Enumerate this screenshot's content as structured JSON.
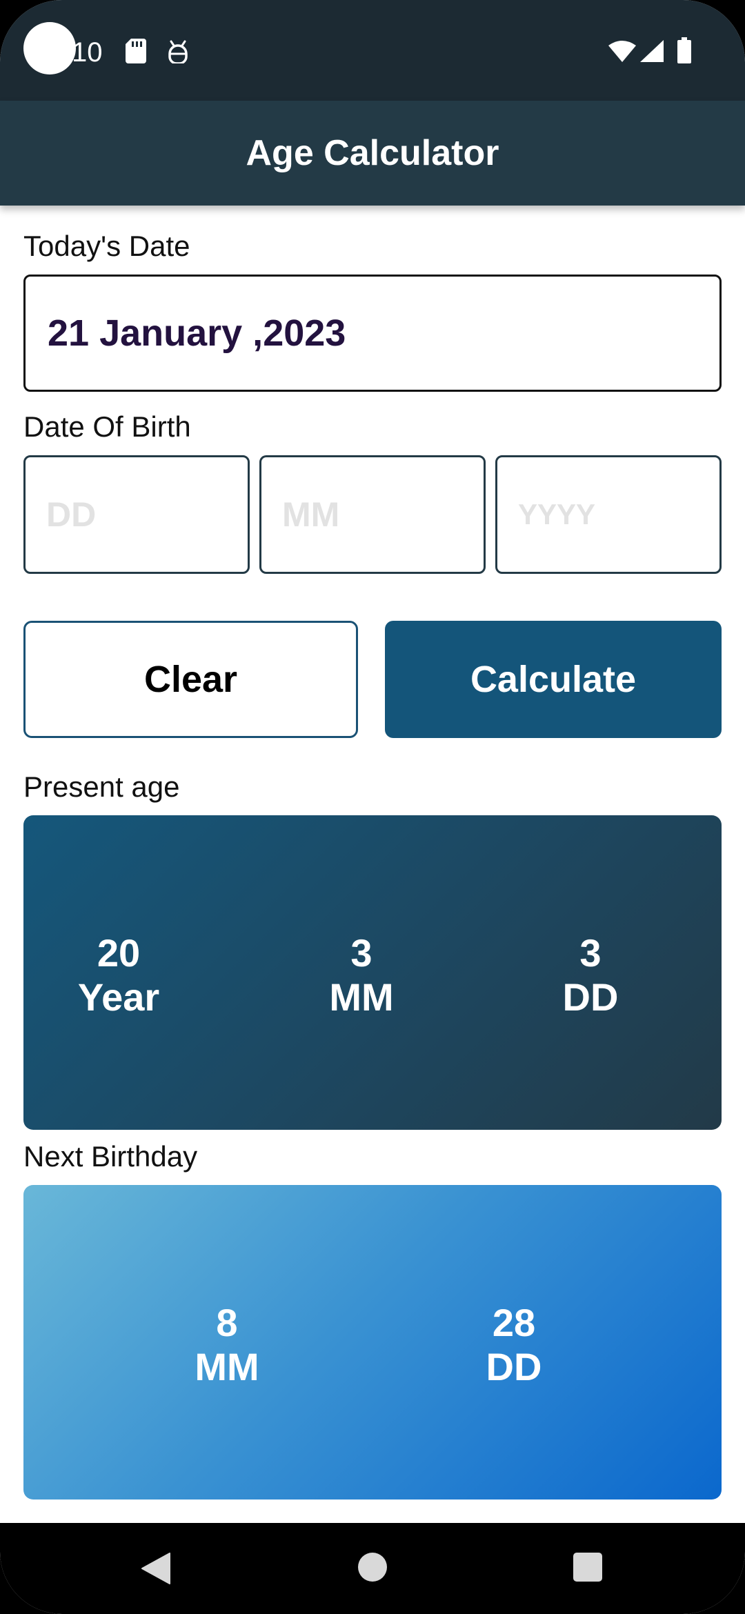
{
  "status_bar": {
    "time": "10",
    "icons": [
      "sd-card-icon",
      "android-debug-icon",
      "wifi-icon",
      "signal-icon",
      "battery-icon"
    ]
  },
  "app_bar": {
    "title": "Age Calculator"
  },
  "today": {
    "label": "Today's Date",
    "value": "21 January ,2023"
  },
  "dob": {
    "label": "Date Of Birth",
    "day_placeholder": "DD",
    "month_placeholder": "MM",
    "year_placeholder": "YYYY"
  },
  "buttons": {
    "clear_label": "Clear",
    "calculate_label": "Calculate"
  },
  "present_age": {
    "label": "Present age",
    "years_value": "20",
    "years_unit": "Year",
    "months_value": "3",
    "months_unit": "MM",
    "days_value": "3",
    "days_unit": "DD"
  },
  "next_birthday": {
    "label": "Next Birthday",
    "months_value": "8",
    "months_unit": "MM",
    "days_value": "28",
    "days_unit": "DD"
  },
  "nav_bar": {
    "icons": [
      "back-icon",
      "home-icon",
      "recents-icon"
    ]
  },
  "colors": {
    "status_bar": "#1c2a33",
    "app_bar": "#233a46",
    "accent": "#14557a",
    "date_text": "#23123f"
  }
}
